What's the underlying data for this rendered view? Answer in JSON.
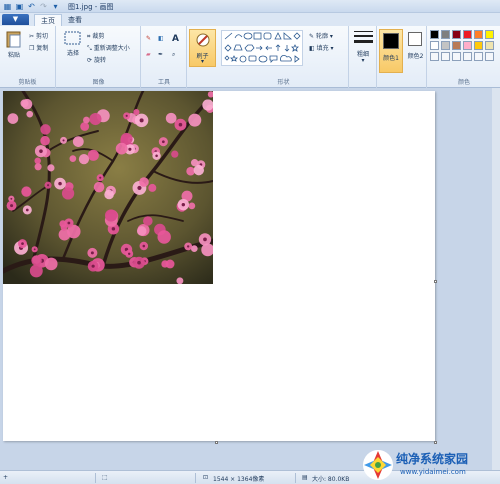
{
  "window": {
    "title": "图1.jpg - 画图"
  },
  "quick_access": {
    "icons": [
      "paint-app-icon",
      "save-icon",
      "undo-icon",
      "redo-icon",
      "dropdown-icon"
    ]
  },
  "tabs": {
    "file": "▼",
    "home": "主页",
    "view": "查看"
  },
  "ribbon": {
    "clipboard": {
      "paste": "粘贴",
      "cut": "剪切",
      "copy": "复制",
      "label": "剪贴板"
    },
    "image": {
      "select": "选择",
      "crop": "裁剪",
      "resize": "重新调整大小",
      "rotate": "旋转",
      "label": "图像"
    },
    "tools": {
      "label": "工具"
    },
    "brushes": {
      "label": "刷子"
    },
    "shapes": {
      "outline": "轮廓",
      "fill": "填充",
      "label": "形状"
    },
    "size": {
      "label": "粗细"
    },
    "color1": {
      "label": "颜色1"
    },
    "color2": {
      "label": "颜色2"
    },
    "colors": {
      "label": "颜色"
    },
    "palette": [
      "#000000",
      "#7f7f7f",
      "#880015",
      "#ed1c24",
      "#ff7f27",
      "#fff200",
      "#ffffff",
      "#c3c3c3",
      "#b97a57",
      "#ffaec9",
      "#ffc90e",
      "#efe4b0"
    ]
  },
  "status": {
    "dimensions": "1544 × 1364像素",
    "size": "大小: 80.0KB",
    "add": "+"
  },
  "watermark": {
    "title": "纯净系统家园",
    "url": "www.yidaimei.com"
  }
}
